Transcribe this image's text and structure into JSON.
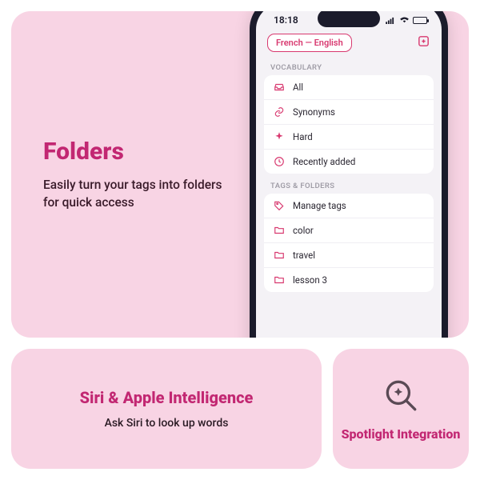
{
  "top": {
    "title": "Folders",
    "subtitle": "Easily turn your tags into folders for quick access"
  },
  "phone": {
    "time": "18:18",
    "language_pair": "French — English",
    "sections": {
      "vocab_label": "VOCABULARY",
      "tags_label": "TAGS & FOLDERS"
    },
    "vocab": [
      {
        "icon": "inbox",
        "label": "All"
      },
      {
        "icon": "link",
        "label": "Synonyms"
      },
      {
        "icon": "sparkle",
        "label": "Hard"
      },
      {
        "icon": "clock",
        "label": "Recently added"
      }
    ],
    "tags": [
      {
        "icon": "tag",
        "label": "Manage tags"
      },
      {
        "icon": "folder",
        "label": "color"
      },
      {
        "icon": "folder",
        "label": "travel"
      },
      {
        "icon": "folder",
        "label": "lesson 3"
      }
    ]
  },
  "siri": {
    "title": "Siri & Apple Intelligence",
    "subtitle": "Ask Siri to look up words"
  },
  "spotlight": {
    "title": "Spotlight Integration"
  }
}
